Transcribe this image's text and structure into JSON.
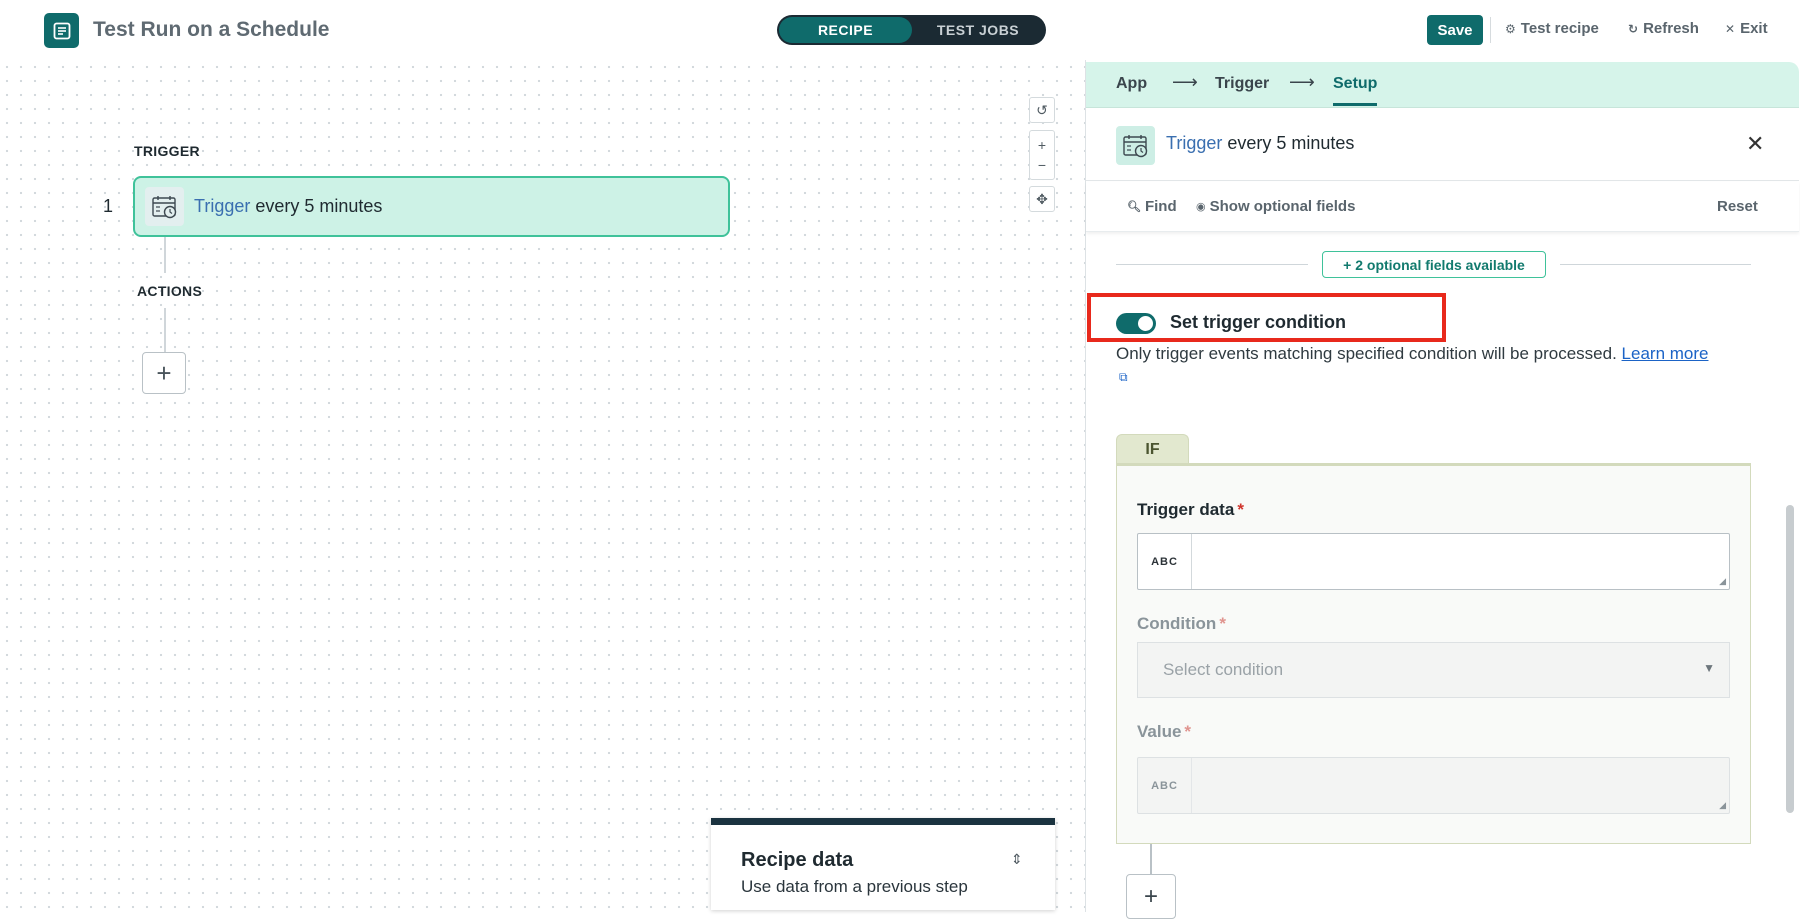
{
  "header": {
    "title": "Test Run on a Schedule",
    "tabs": [
      "RECIPE",
      "TEST JOBS"
    ],
    "save_label": "Save",
    "test_recipe_label": "Test recipe",
    "refresh_label": "Refresh",
    "exit_label": "Exit"
  },
  "canvas": {
    "trigger_label": "TRIGGER",
    "actions_label": "ACTIONS",
    "step_number": "1",
    "trigger_link": "Trigger",
    "trigger_text": " every 5 minutes",
    "add_step_symbol": "+",
    "zoom": {
      "reset": "↺",
      "in": "+",
      "out": "−",
      "fit": "✥"
    }
  },
  "recipe_data": {
    "title": "Recipe data",
    "subtitle": "Use data from a previous step",
    "icon": "⇕"
  },
  "panel": {
    "breadcrumbs": [
      "App",
      "Trigger",
      "Setup"
    ],
    "arrow": "⟶",
    "header_link": "Trigger",
    "header_text": " every 5 minutes",
    "close_symbol": "✕",
    "find_label": "Find",
    "show_optional_label": "Show optional fields",
    "reset_label": "Reset",
    "optional_fields": "+ 2 optional fields available",
    "trigger_condition_label": "Set trigger condition",
    "trigger_condition_desc": "Only trigger events matching specified condition will be processed. ",
    "learn_more": "Learn more",
    "if_label": "IF",
    "trigger_data_label": "Trigger data",
    "condition_label": "Condition",
    "value_label": "Value",
    "required_marker": "*",
    "abc": "ABC",
    "select_placeholder": "Select condition",
    "add_condition_symbol": "+"
  },
  "colors": {
    "accent": "#0f6b6b",
    "trigger_card_bg": "#cdf2e6",
    "highlight_box": "#e8291c"
  }
}
